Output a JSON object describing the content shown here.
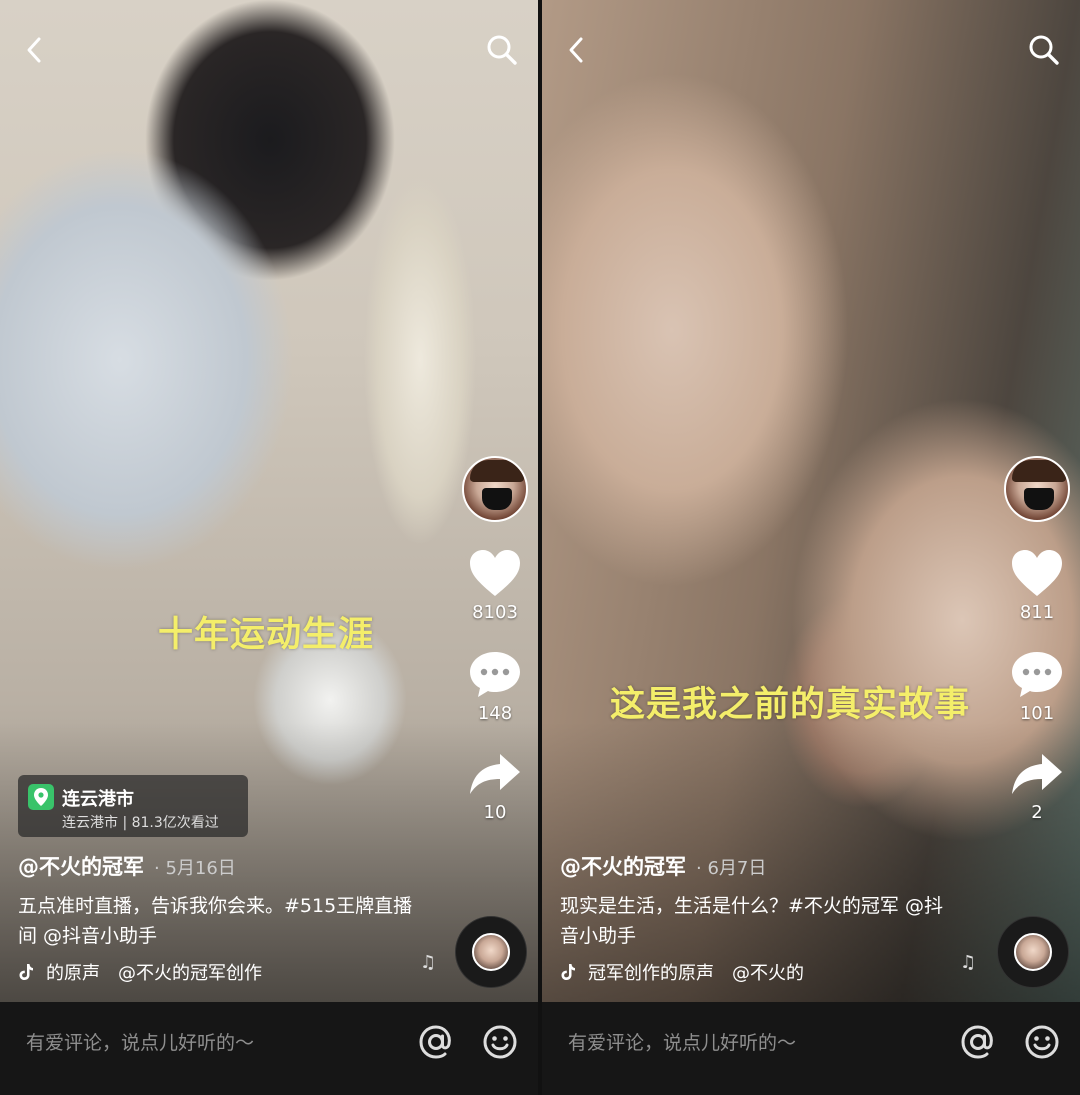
{
  "left": {
    "caption": "十年运动生涯",
    "likes": "8103",
    "comments": "148",
    "shares": "10",
    "location": {
      "city": "连云港市",
      "sub": "连云港市 | 81.3亿次看过"
    },
    "author": "@不火的冠军",
    "date": "· 5月16日",
    "description": "五点准时直播，告诉我你会来。#515王牌直播间 @抖音小助手",
    "music": "的原声　@不火的冠军创作",
    "comment_placeholder": "有爱评论，说点儿好听的～"
  },
  "right": {
    "caption": "这是我之前的真实故事",
    "likes": "811",
    "comments": "101",
    "shares": "2",
    "author": "@不火的冠军",
    "date": "· 6月7日",
    "description": "现实是生活，生活是什么？#不火的冠军 @抖音小助手",
    "music": "冠军创作的原声　@不火的",
    "comment_placeholder": "有爱评论，说点儿好听的～"
  }
}
